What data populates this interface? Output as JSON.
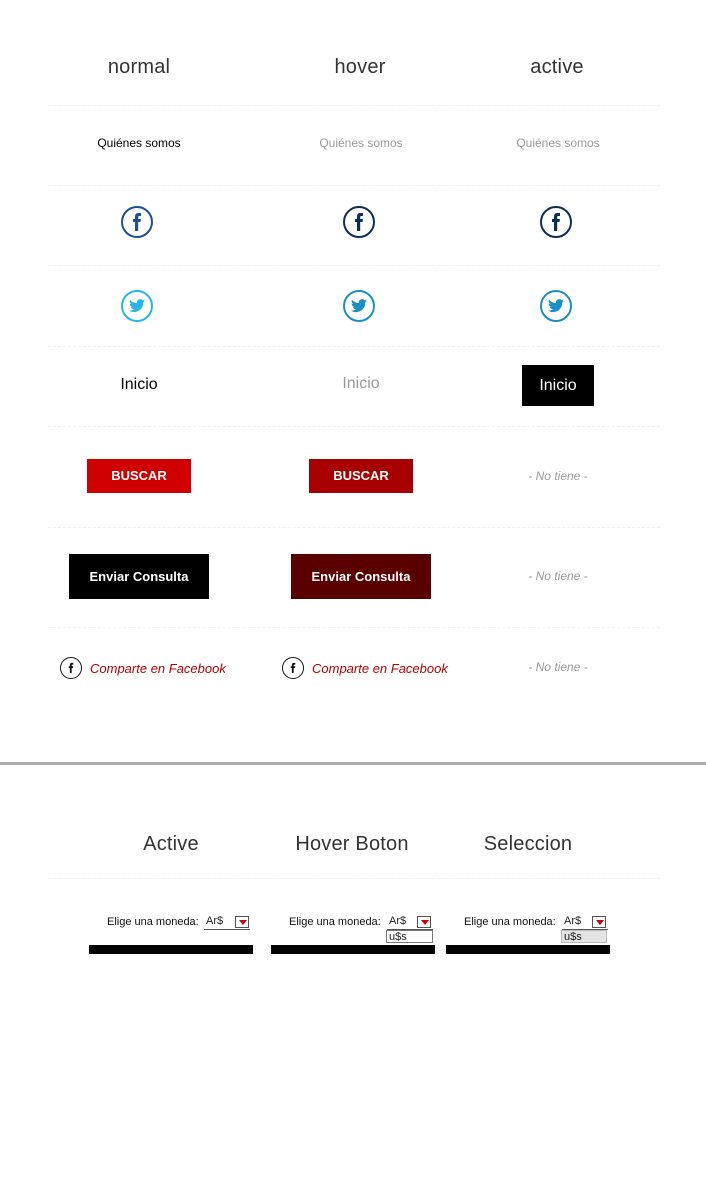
{
  "headers1": [
    "normal",
    "hover",
    "active"
  ],
  "nav_link": "Quiénes somos",
  "icons": {
    "facebook": "facebook-icon",
    "twitter": "twitter-icon"
  },
  "inicio": "Inicio",
  "buscar": "BUSCAR",
  "enviar": "Enviar Consulta",
  "share": "Comparte en Facebook",
  "none": "- No tiene -",
  "headers2": [
    "Active",
    "Hover Boton",
    "Seleccion"
  ],
  "currency": {
    "label": "Elige una moneda:",
    "selected": "Ar$",
    "option": "u$s"
  },
  "colors": {
    "nav_normal": "#000000",
    "nav_muted": "#999999",
    "facebook_blue": "#1d4e9a",
    "facebook_dark": "#0b2d57",
    "twitter_blue": "#28b6e8",
    "twitter_dark": "#1a8fc4",
    "buscar_normal": "#d10000",
    "buscar_hover": "#a80000",
    "enviar_normal": "#000000",
    "enviar_hover": "#5a0000",
    "share_text": "#b50000"
  }
}
